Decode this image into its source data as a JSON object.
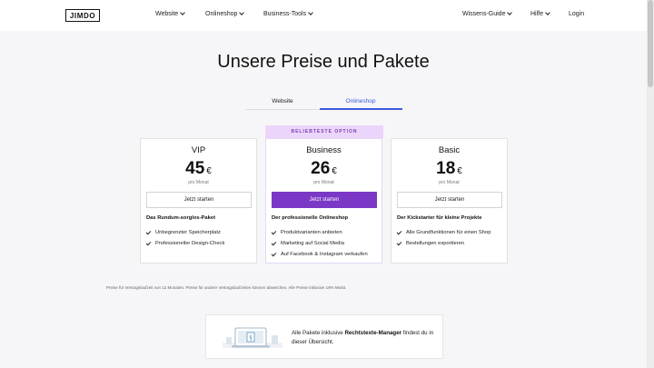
{
  "header": {
    "logo": "JIMDO",
    "nav_left": [
      "Website",
      "Onlineshop",
      "Business-Tools"
    ],
    "nav_right": [
      "Wissens-Guide",
      "Hilfe"
    ],
    "login": "Login"
  },
  "page_title": "Unsere Preise und Pakete",
  "tabs": [
    {
      "label": "Website",
      "active": false
    },
    {
      "label": "Onlineshop",
      "active": true
    }
  ],
  "featured_badge": "BELIEBTESTE OPTION",
  "plans": [
    {
      "name": "VIP",
      "price": "45",
      "currency": "€",
      "period": "pro Monat",
      "button": "Jetzt starten",
      "primary": false,
      "description": "Das Rundum-sorglos-Paket",
      "features": [
        "Unbegrenzter Speicherplatz",
        "Professioneller Design-Check"
      ]
    },
    {
      "name": "Business",
      "price": "26",
      "currency": "€",
      "period": "pro Monat",
      "button": "Jetzt starten",
      "primary": true,
      "description": "Der professionelle Onlineshop",
      "features": [
        "Produktvarianten anbieten",
        "Marketing auf Social Media",
        "Auf Facebook & Instagram verkaufen"
      ]
    },
    {
      "name": "Basic",
      "price": "18",
      "currency": "€",
      "period": "pro Monat",
      "button": "Jetzt starten",
      "primary": false,
      "description": "Der Kickstarter für kleine Projekte",
      "features": [
        "Alle Grundfunktionen für einen Shop",
        "Bestellungen exportieren"
      ]
    }
  ],
  "footnote": "Preise für Vertragslaufzeit von 12 Monaten. Preise für andere Vertragslaufzeiten können abweichen. Alle Preise inklusive 19% MwSt.",
  "info": {
    "prefix": "Alle Pakete inklusive ",
    "bold": "Rechtstexte-Manager",
    "suffix": " findest du in dieser Übersicht."
  },
  "colors": {
    "accent": "#7b38c6",
    "tab_active": "#3b5bdb",
    "badge_bg": "#ecd5fb"
  }
}
